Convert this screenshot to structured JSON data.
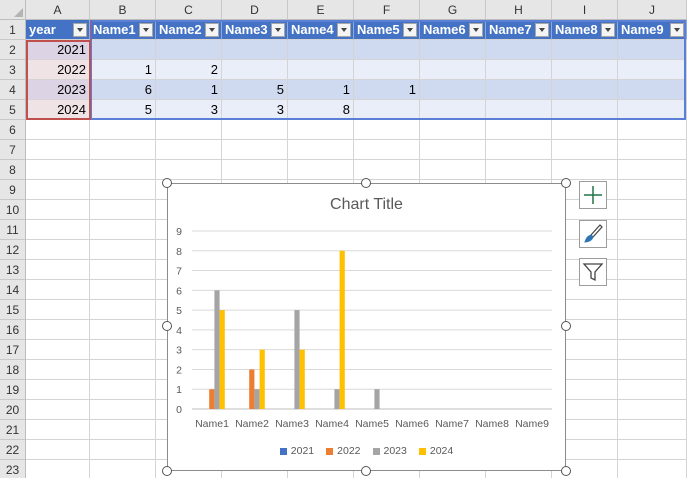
{
  "columns": [
    "A",
    "B",
    "C",
    "D",
    "E",
    "F",
    "G",
    "H",
    "I",
    "J"
  ],
  "rows": [
    "1",
    "2",
    "3",
    "4",
    "5",
    "6",
    "7",
    "8",
    "9",
    "10",
    "11",
    "12",
    "13",
    "14",
    "15",
    "16",
    "17",
    "18",
    "19",
    "20",
    "21",
    "22",
    "23"
  ],
  "table": {
    "headers": [
      "year",
      "Name1",
      "Name2",
      "Name3",
      "Name4",
      "Name5",
      "Name6",
      "Name7",
      "Name8",
      "Name9"
    ],
    "body": [
      [
        "2021",
        "",
        "",
        "",
        "",
        "",
        "",
        "",
        "",
        ""
      ],
      [
        "2022",
        "1",
        "2",
        "",
        "",
        "",
        "",
        "",
        "",
        ""
      ],
      [
        "2023",
        "6",
        "1",
        "5",
        "1",
        "1",
        "",
        "",
        "",
        ""
      ],
      [
        "2024",
        "5",
        "3",
        "3",
        "8",
        "",
        "",
        "",
        "",
        ""
      ]
    ]
  },
  "chart": {
    "title": "Chart Title"
  },
  "chart_data": {
    "type": "bar",
    "title": "Chart Title",
    "categories": [
      "Name1",
      "Name2",
      "Name3",
      "Name4",
      "Name5",
      "Name6",
      "Name7",
      "Name8",
      "Name9"
    ],
    "series": [
      {
        "name": "2021",
        "color": "#4472c4",
        "values": [
          0,
          0,
          0,
          0,
          0,
          0,
          0,
          0,
          0
        ]
      },
      {
        "name": "2022",
        "color": "#ed7d31",
        "values": [
          1,
          2,
          0,
          0,
          0,
          0,
          0,
          0,
          0
        ]
      },
      {
        "name": "2023",
        "color": "#a5a5a5",
        "values": [
          6,
          1,
          5,
          1,
          1,
          0,
          0,
          0,
          0
        ]
      },
      {
        "name": "2024",
        "color": "#ffc000",
        "values": [
          5,
          3,
          3,
          8,
          0,
          0,
          0,
          0,
          0
        ]
      }
    ],
    "yticks": [
      "0",
      "1",
      "2",
      "3",
      "4",
      "5",
      "6",
      "7",
      "8",
      "9"
    ],
    "ylim": [
      0,
      9
    ],
    "grid": true,
    "legend_position": "bottom",
    "xlabel": "",
    "ylabel": ""
  },
  "chart_side_buttons": [
    {
      "icon": "plus-icon",
      "label": "Chart Elements"
    },
    {
      "icon": "paintbrush-icon",
      "label": "Chart Styles"
    },
    {
      "icon": "funnel-icon",
      "label": "Chart Filters"
    }
  ],
  "colors": {
    "table_header": "#4472c4",
    "accent": "#217346"
  }
}
